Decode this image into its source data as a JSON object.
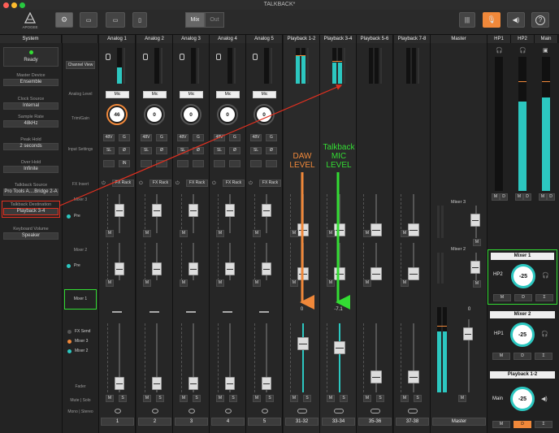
{
  "app": {
    "title": "TALKBACK*",
    "logo_text": "APOGEE"
  },
  "toolbar": {
    "mix_label": "Mix",
    "out_label": "Out"
  },
  "left_panel": {
    "header": "System",
    "status": "Ready",
    "fields": [
      {
        "label": "Master Device",
        "value": "Ensemble"
      },
      {
        "label": "Clock Source",
        "value": "Internal"
      },
      {
        "label": "Sample Rate",
        "value": "48kHz"
      },
      {
        "label": "Peak Hold",
        "value": "2 seconds"
      },
      {
        "label": "Over Hold",
        "value": "Infinite"
      },
      {
        "label": "Talkback Source",
        "value": "Pro Tools A....Bridge 2-A"
      },
      {
        "label": "Talkback Destination",
        "value": "Playback 3-4"
      },
      {
        "label": "Keyboard Volume",
        "value": "Speaker"
      }
    ]
  },
  "row_labels": {
    "channel_view": "Channel View",
    "analog_level": "Analog Level",
    "trim_gain": "Trim/Gain",
    "input_settings": "Input Settings",
    "fx_insert": "FX Insert",
    "mixer3": "Mixer 3",
    "mixer2": "Mixer 2",
    "mixer1": "Mixer 1",
    "pre": "Pre",
    "fx_send": "FX Send",
    "mixer3_cb": "Mixer 3",
    "mixer2_cb": "Mixer 2",
    "fader": "Fader",
    "mute_solo": "Mute | Solo",
    "mono_stereo": "Mono | Stereo"
  },
  "channels": [
    {
      "name": "Analog 1",
      "level": "Mic",
      "gain": "46",
      "num": "1"
    },
    {
      "name": "Analog 2",
      "level": "Mic",
      "gain": "0",
      "num": "2"
    },
    {
      "name": "Analog 3",
      "level": "Mic",
      "gain": "0",
      "num": "3"
    },
    {
      "name": "Analog 4",
      "level": "Mic",
      "gain": "0",
      "num": "4"
    },
    {
      "name": "Analog 5",
      "level": "Mic",
      "gain": "0",
      "num": "5"
    }
  ],
  "playbacks": [
    {
      "name": "Playback 1-2",
      "num": "31-32",
      "fader_value": "0"
    },
    {
      "name": "Playback 3-4",
      "num": "33-34",
      "fader_value": "-7.1"
    },
    {
      "name": "Playback 5-6",
      "num": "35-36",
      "fader_value": ""
    },
    {
      "name": "Playback 7-8",
      "num": "37-38",
      "fader_value": ""
    }
  ],
  "master": {
    "name": "Master",
    "num": "Master",
    "fader_value": "0",
    "mixer3": "Mixer 3",
    "mixer2": "Mixer 2"
  },
  "buttons": {
    "v48": "48V",
    "g": "G",
    "sl": "SL",
    "phase": "Ø",
    "in": "IN",
    "fx_rack": "FX Rack",
    "m": "M",
    "s": "S",
    "d": "D",
    "sum": "Σ"
  },
  "hp": {
    "labels": [
      "HP1",
      "HP2",
      "Main"
    ],
    "mixer1": {
      "title": "Mixer 1",
      "out": "HP2",
      "value": "-25"
    },
    "mixer2": {
      "title": "Mixer 2",
      "out": "HP1",
      "value": "-25"
    },
    "playback12": {
      "title": "Playback 1-2",
      "out": "Main",
      "value": "-25"
    }
  },
  "annotations": {
    "daw": "DAW\nLEVEL",
    "talkback": "Talkback\nMIC\nLEVEL"
  },
  "colors": {
    "accent": "#f0883a",
    "teal": "#2cc7c0",
    "green": "#33dd33",
    "red": "#e03020"
  }
}
